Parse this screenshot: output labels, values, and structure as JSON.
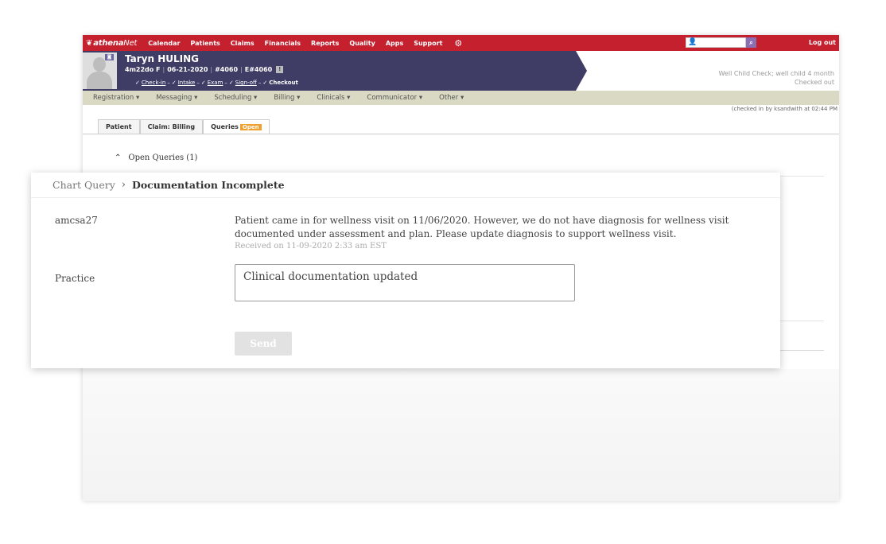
{
  "app": {
    "brand_main": "athena",
    "brand_net": "Net",
    "nav_items": [
      "Calendar",
      "Patients",
      "Claims",
      "Financials",
      "Reports",
      "Quality",
      "Apps",
      "Support"
    ],
    "logout_label": "Log out"
  },
  "patient": {
    "name": "Taryn HULING",
    "age_sex": "4m22do F",
    "dob": "06-21-2020",
    "patient_id": "#4060",
    "enterprise_id": "E#4060",
    "alert_glyph": "!",
    "steps": [
      "Check-in",
      "Intake",
      "Exam",
      "Sign-off"
    ],
    "final_step": "Checkout",
    "visit_type": "Well Child Check; well child 4 month",
    "visit_status": "Checked out"
  },
  "menu": {
    "items": [
      "Registration ▾",
      "Messaging ▾",
      "Scheduling ▾",
      "Billing ▾",
      "Clinicals ▾",
      "Communicator ▾",
      "Other ▾"
    ],
    "checked_note": "(checked in by ksandwith at 02:44 PM"
  },
  "tabs": {
    "patient": "Patient",
    "claim_billing": "Claim: Billing",
    "queries": "Queries",
    "queries_badge": "Open"
  },
  "queries_section": {
    "open_label": "Open Queries (1)"
  },
  "card": {
    "breadcrumb_parent": "Chart Query",
    "breadcrumb_current": "Documentation Incomplete",
    "user": "amcsa27",
    "query_text": "Patient came in for wellness visit on 11/06/2020. However, we do not have diagnosis for wellness visit documented under assessment and plan. Please update diagnosis to support wellness visit.",
    "received": "Received on 11-09-2020 2:33 am EST",
    "practice_label": "Practice",
    "response_value": "Clinical documentation updated",
    "send_label": "Send"
  }
}
